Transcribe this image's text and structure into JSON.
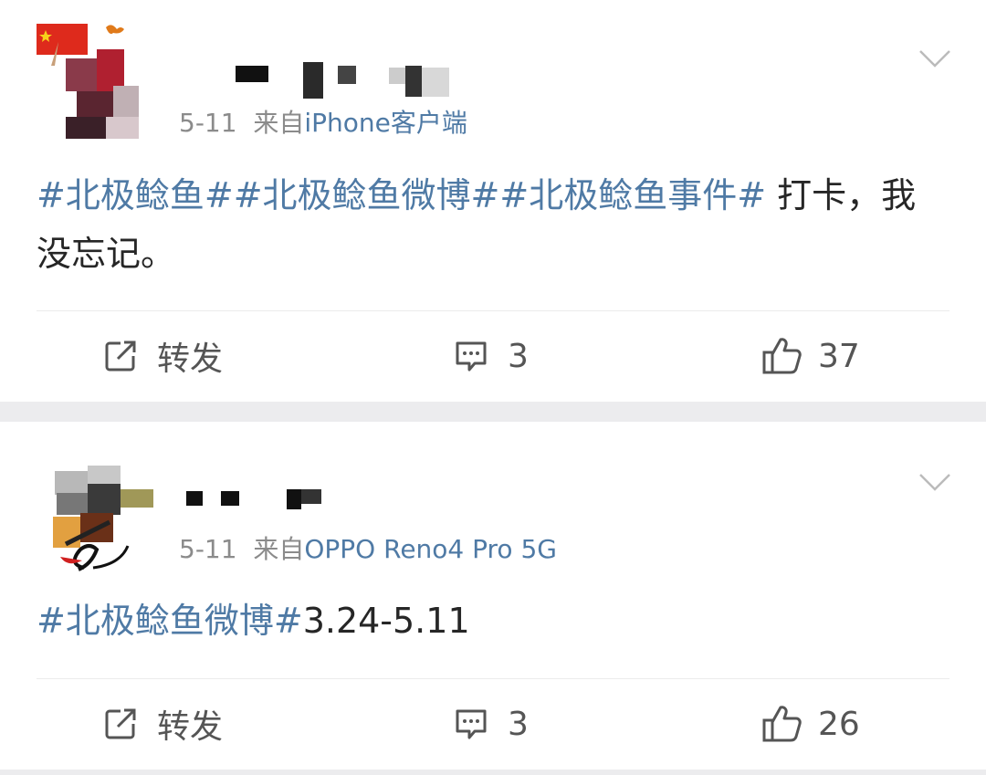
{
  "colors": {
    "link": "#4f7aa5",
    "meta": "#8b8b8b",
    "text": "#262626",
    "action": "#555555",
    "background": "#ececee"
  },
  "posts": [
    {
      "date": "5-11",
      "from_label": "来自",
      "source": "iPhone客户端",
      "tags": [
        "#北极鲶鱼#",
        "#北极鲶鱼微博#",
        "#北极鲶鱼事件#"
      ],
      "text": " 打卡，我没忘记。",
      "actions": {
        "repost_label": "转发",
        "comments": "3",
        "likes": "37"
      },
      "icons": {
        "avatar_badge": "china-flag-icon",
        "menu": "chevron-down-icon"
      }
    },
    {
      "date": "5-11",
      "from_label": "来自",
      "source": "OPPO Reno4 Pro 5G",
      "tags": [
        "#北极鲶鱼微博#"
      ],
      "text": "3.24-5.11",
      "actions": {
        "repost_label": "转发",
        "comments": "3",
        "likes": "26"
      },
      "icons": {
        "menu": "chevron-down-icon"
      }
    }
  ]
}
